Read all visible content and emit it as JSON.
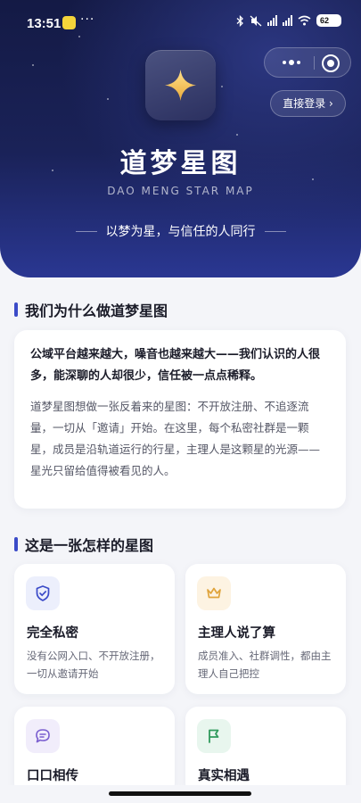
{
  "status_bar": {
    "time": "13:51",
    "more": "···",
    "battery": "62",
    "icons": [
      "bluetooth-icon",
      "mute-icon",
      "signal-5g-icon",
      "signal-5g-icon",
      "wifi-icon",
      "battery-icon"
    ]
  },
  "header": {
    "login_label": "直接登录 ›",
    "logo_icon": "sparkle-icon",
    "title": "道梦星图",
    "subtitle": "DAO MENG STAR MAP",
    "tagline": "以梦为星，与信任的人同行"
  },
  "why_section": {
    "title": "我们为什么做道梦星图",
    "lead": "公域平台越来越大，噪音也越来越大——我们认识的人很多，能深聊的人却很少，信任被一点点稀释。",
    "body": "道梦星图想做一张反着来的星图：不开放注册、不追逐流量，一切从「邀请」开始。在这里，每个私密社群是一颗星，成员是沿轨道运行的行星，主理人是这颗星的光源——星光只留给值得被看见的人。"
  },
  "what_section": {
    "title": "这是一张怎样的星图",
    "features": [
      {
        "icon": "shield-check-icon",
        "title": "完全私密",
        "desc": "没有公网入口、不开放注册，一切从邀请开始",
        "icon_bg": "#eceffc",
        "icon_color": "#3b4bc8"
      },
      {
        "icon": "crown-icon",
        "title": "主理人说了算",
        "desc": "成员准入、社群调性，都由主理人自己把控",
        "icon_bg": "#fdf3e2",
        "icon_color": "#e0a43c"
      },
      {
        "icon": "chat-bubble-icon",
        "title": "口口相传",
        "desc": "",
        "icon_bg": "#f1edfb",
        "icon_color": "#7b5fd0"
      },
      {
        "icon": "flag-icon",
        "title": "真实相遇",
        "desc": "",
        "icon_bg": "#e8f6ee",
        "icon_color": "#2f9a5c"
      }
    ]
  }
}
